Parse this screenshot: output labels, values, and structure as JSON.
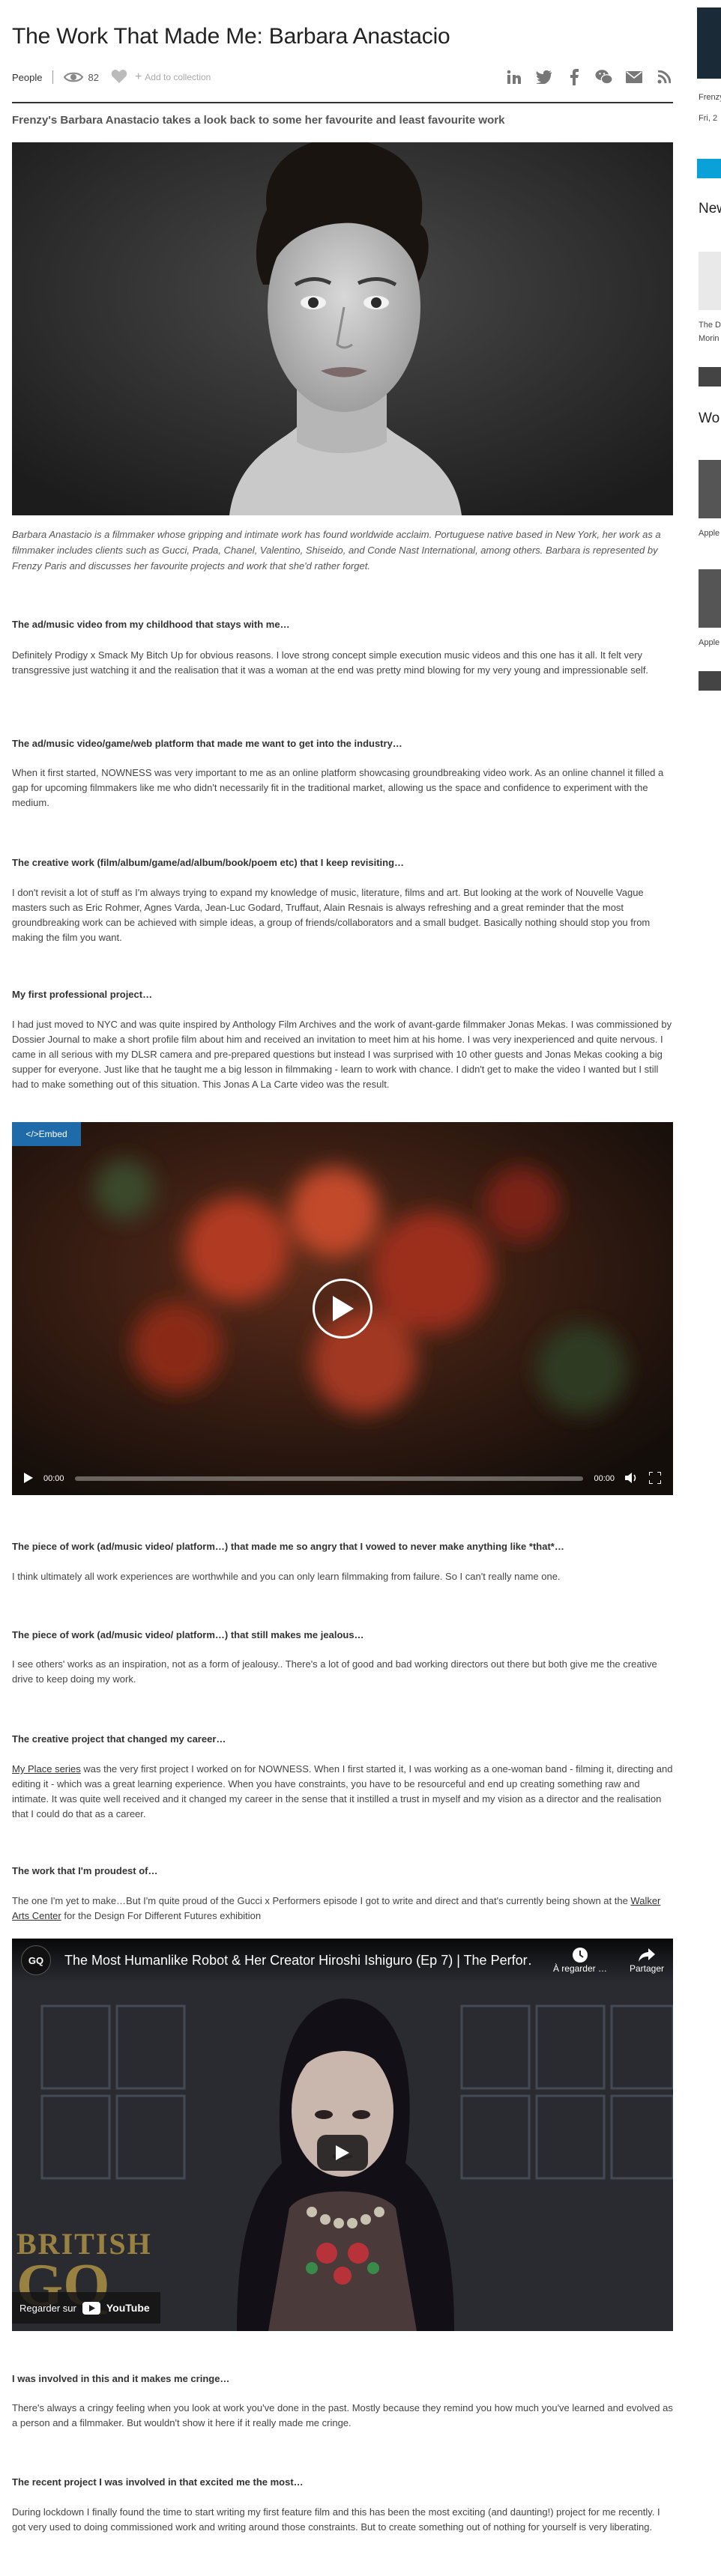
{
  "article": {
    "title": "The Work That Made Me: Barbara Anastacio",
    "category": "People",
    "views": "82",
    "add_to_collection": "Add to collection",
    "share_icons": [
      "linkedin-icon",
      "twitter-icon",
      "facebook-icon",
      "wechat-icon",
      "email-icon",
      "rss-icon"
    ],
    "standfirst": "Frenzy's Barbara Anastacio takes a look back to some her favourite and least favourite work",
    "caption": "Barbara Anastacio is a filmmaker whose gripping and intimate work has found worldwide acclaim. Portuguese native based in New York, her work as a filmmaker includes clients such as Gucci, Prada, Chanel, Valentino, Shiseido, and Conde Nast International, among others. Barbara is represented by Frenzy Paris and discusses her favourite projects and work that she'd rather forget.",
    "sections": [
      {
        "q": "The ad/music video from my childhood that stays with me…",
        "a": "Definitely Prodigy x Smack My Bitch Up for obvious reasons. I love strong concept simple execution music videos and this one has it all. It felt very transgressive just watching it and the realisation that it was a woman at the end was pretty mind blowing for my very young and impressionable self."
      },
      {
        "q": "The ad/music video/game/web platform that made me want to get into the industry…",
        "a": "When it first started, NOWNESS was very important to me as an online platform showcasing groundbreaking video work. As an online channel it filled a gap for upcoming filmmakers like me who didn't necessarily fit in the traditional market, allowing us the space and confidence to experiment with the medium."
      },
      {
        "q": "The creative work (film/album/game/ad/album/book/poem etc) that I keep revisiting…",
        "a": "I don't revisit a lot of stuff as I'm always trying to expand my knowledge of music, literature, films and art. But looking at the work of Nouvelle Vague masters such as Eric Rohmer, Agnes Varda, Jean-Luc Godard, Truffaut, Alain Resnais is always refreshing and a great reminder that the most groundbreaking work can be achieved with simple ideas, a group of friends/collaborators and a small budget. Basically nothing should stop you from making the film you want."
      },
      {
        "q": "My first professional project…",
        "a": "I had just moved to NYC and was quite inspired by Anthology Film Archives and the work of avant-garde filmmaker Jonas Mekas. I was commissioned by Dossier Journal to make a short profile film about him and received an invitation to meet him at his home. I was very inexperienced and quite nervous. I came in all serious with my DLSR camera and pre-prepared questions but instead I was surprised with 10 other guests and Jonas Mekas cooking a big supper for everyone. Just like that he taught me a big lesson in filmmaking - learn to work with chance. I didn't get to make the video I wanted but I still had to make something out of this situation. This Jonas A La Carte video was the result."
      },
      {
        "q": "The piece of work (ad/music video/ platform…) that made me so angry that I vowed to never make anything like *that*…",
        "a": "I think ultimately all work experiences are worthwhile and you can only learn filmmaking from failure. So I can't really name one."
      },
      {
        "q": "The piece of work (ad/music video/ platform…) that still makes me jealous…",
        "a": "I see others' works as an inspiration, not as a form of jealousy.. There's a lot of good and bad working directors out there but both give me the creative drive to keep doing my work."
      },
      {
        "q": "The creative project that changed my career…",
        "link": "My Place series",
        "a": " was the very first project I worked on for NOWNESS. When I first started it, I was working as a one-woman band - filming it, directing and editing it -  which was a great learning experience. When you have constraints, you have to be resourceful and end up creating something raw and intimate. It was quite well received and it changed my career in the sense that it instilled a trust in myself and my vision as a director and the realisation that I could do that as a career."
      },
      {
        "q": "The work that I'm proudest of…",
        "a_pre": "The one I'm yet to make…But I'm quite proud of the Gucci x Performers episode I got to write and direct and that's currently being shown at the ",
        "link": "Walker Arts Center",
        "a_post": " for the Design For Different Futures exhibition"
      },
      {
        "q": "I was involved in this and it makes me cringe…",
        "a": "There's always a cringy feeling when you look at work you've done in the past. Mostly because they remind you how much you've learned and evolved as a person and a filmmaker. But wouldn't show it here if it really made me cringe."
      },
      {
        "q": "The recent project I was involved in that excited me the most…",
        "a": "During lockdown I finally found the time to start writing my first feature film and this has been the most exciting (and daunting!) project for me recently. I got very used to doing commissioned work and writing around those constraints. But to create something out of nothing for yourself is very liberating."
      }
    ]
  },
  "video1": {
    "embed_label": "</>Embed",
    "time_current": "00:00",
    "time_total": "00:00"
  },
  "video2": {
    "channel": "GQ",
    "title": "The Most Humanlike Robot & Her Creator Hiroshi Ishiguro (Ep 7) | The Perfor…",
    "watch_later": "À regarder …",
    "share": "Partager",
    "watch_on": "Regarder sur",
    "youtube": "YouTube",
    "watermark_top": "BRITISH",
    "watermark_bottom": "GQ"
  },
  "sidebar": {
    "author_line": "Frenzy",
    "date_line": "Fri, 2",
    "heading_news": "New",
    "news_text_1": "The D",
    "news_text_2": "Morin",
    "heading_work": "Wo",
    "work_label_1": "Apple",
    "work_label_2": "Apple"
  },
  "colors": {
    "accent_blue": "#0aa0d8",
    "embed_blue": "#1f6aa8",
    "text": "#333333"
  }
}
